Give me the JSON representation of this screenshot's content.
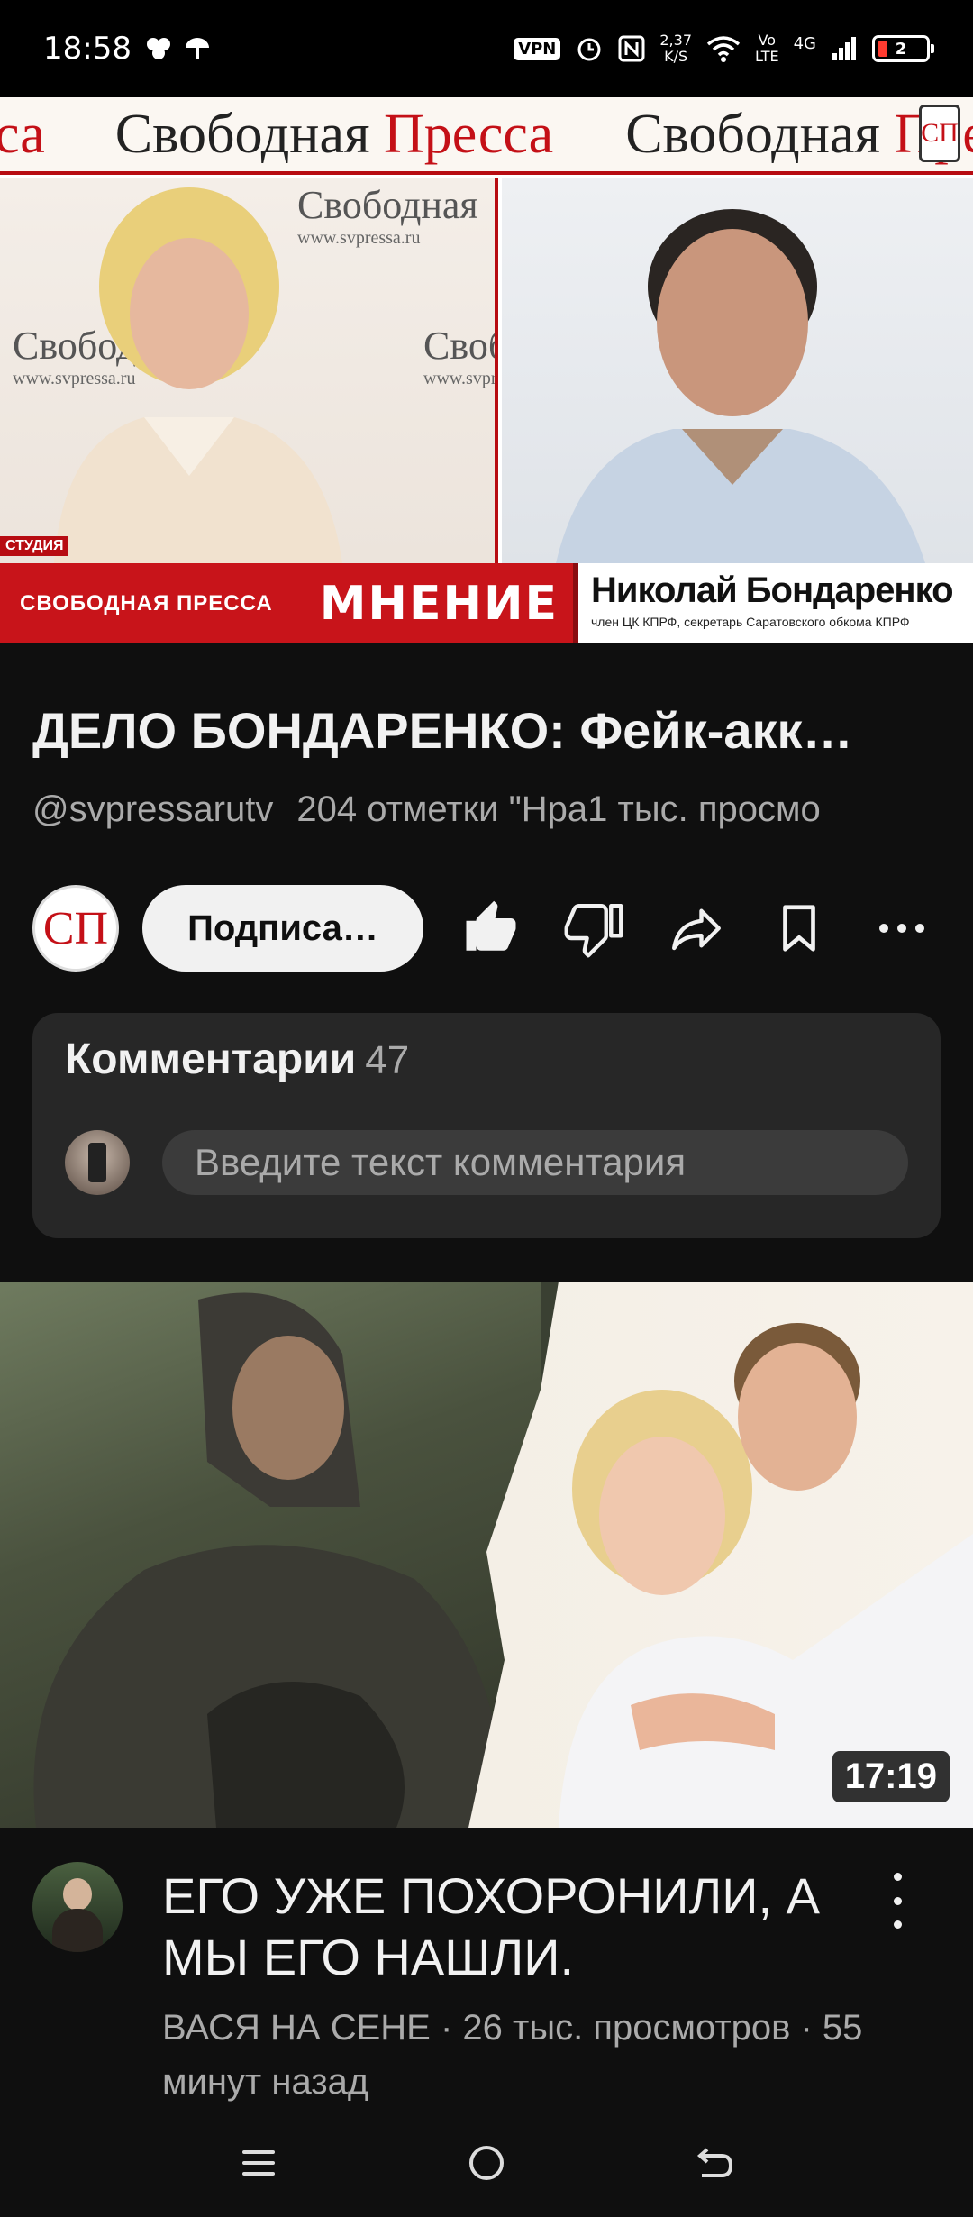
{
  "status_bar": {
    "time": "18:58",
    "left_icons": [
      "flower-icon",
      "umbrella-icon"
    ],
    "vpn": "VPN",
    "speed_value": "2,37",
    "speed_unit": "K/S",
    "network_top": "Vo",
    "network_bottom": "LTE",
    "network_type": "4G",
    "battery": "2"
  },
  "player": {
    "banner_items": [
      {
        "black": "",
        "red": "са"
      },
      {
        "black": "Свободная ",
        "red": "Пресса"
      },
      {
        "black": "Свободная ",
        "red": "Пресса"
      }
    ],
    "watermark_title": "Свободная",
    "watermark_url": "www.svpressa.ru",
    "studio_tag": "СТУДИЯ",
    "channel_label": "СВОБОДНАЯ ПРЕССА",
    "segment": "МНЕНИЕ",
    "guest_name": "Николай Бондаренко",
    "guest_role": "член ЦК КПРФ, секретарь Саратовского обкома КПРФ",
    "logo": "СП"
  },
  "video": {
    "title": "ДЕЛО БОНДАРЕНКО: Фейк-акк…",
    "channel_handle": "@svpressarutv",
    "likes": "204 отметки \"Нра",
    "views": "1 тыс. просмо",
    "subscribe_label": "Подписа…",
    "channel_avatar_text": "СП"
  },
  "comments": {
    "header": "Комментарии",
    "count": "47",
    "placeholder": "Введите текст комментария"
  },
  "next_video": {
    "duration": "17:19",
    "title": "ЕГО УЖЕ ПОХОРОНИЛИ, А МЫ ЕГО НАШЛИ.",
    "channel": "ВАСЯ НА СЕНЕ",
    "meta": "ВАСЯ НА СЕНЕ · 26 тыс. просмотров · 55 минут назад"
  },
  "nav": [
    "menu-icon",
    "home-icon",
    "back-icon"
  ],
  "colors": {
    "background": "#0f0f0f",
    "brand_red": "#c8141a",
    "card": "#272727"
  }
}
